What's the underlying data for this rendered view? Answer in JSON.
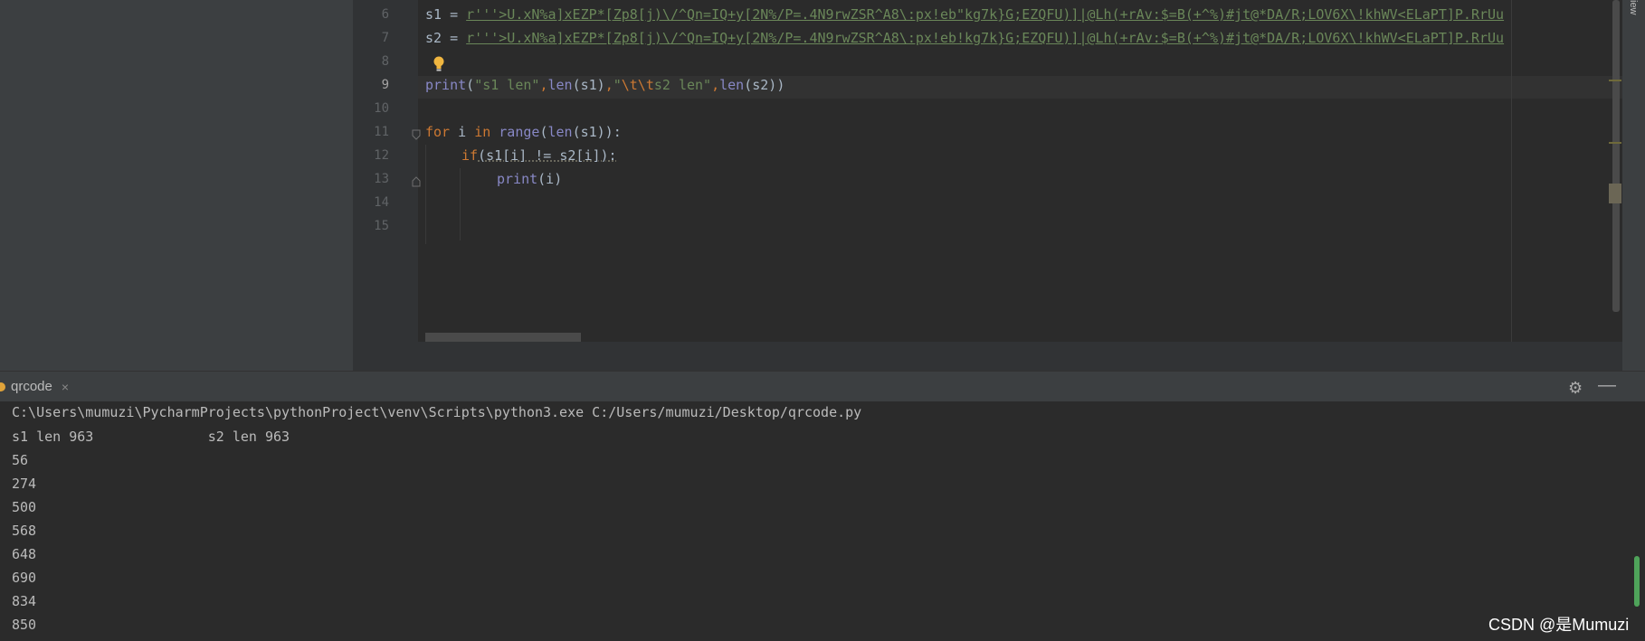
{
  "right_strip_label": "iew",
  "editor": {
    "lines": [
      {
        "num": "6",
        "code": {
          "var": "s1",
          "assign": " = ",
          "string": "r'''>U.xN%a]xEZP*[Zp8[j)\\/^Qn=IQ+y[2N%/P=.4N9rwZSR^A8\\:px!eb\"kg7k}G;EZQFU)]|@Lh(+rAv:$=B(+^%)#jt@*DA/R;LOV6X\\!khWV<ELaPT]P.RrUu"
        }
      },
      {
        "num": "7",
        "code": {
          "var": "s2",
          "assign": " = ",
          "string": "r'''>U.xN%a]xEZP*[Zp8[j)\\/^Qn=IQ+y[2N%/P=.4N9rwZSR^A8\\:px!eb!kg7k}G;EZQFU)]|@Lh(+rAv:$=B(+^%)#jt@*DA/R;LOV6X\\!khWV<ELaPT]P.RrUu"
        }
      },
      {
        "num": "8"
      },
      {
        "num": "9",
        "code": {
          "print": "print",
          "p1": "(",
          "s1": "\"s1 len\"",
          "c1": ",",
          "len1": "len",
          "a1": "(s1)",
          "c2": ",",
          "s2a": "\"",
          "esc": "\\t\\t",
          "s2b": "s2 len\"",
          "c3": ",",
          "len2": "len",
          "a2": "(s2))"
        }
      },
      {
        "num": "10"
      },
      {
        "num": "11",
        "code": {
          "for": "for",
          "i": " i ",
          "in": "in",
          "sp": " ",
          "range": "range",
          "p": "(",
          "len": "len",
          "rest": "(s1)):"
        }
      },
      {
        "num": "12",
        "code": {
          "if": "if",
          "rest": "(s1[i] != s2[i]):"
        }
      },
      {
        "num": "13",
        "code": {
          "print": "print",
          "rest": "(i)"
        }
      },
      {
        "num": "14"
      },
      {
        "num": "15"
      }
    ]
  },
  "run_panel": {
    "tab_label": "qrcode",
    "tab_close": "×",
    "settings_icon": "gear-icon",
    "minimize_icon": "minimize-icon"
  },
  "console": {
    "command": "C:\\Users\\mumuzi\\PycharmProjects\\pythonProject\\venv\\Scripts\\python3.exe C:/Users/mumuzi/Desktop/qrcode.py",
    "summary": "s1 len 963\t\ts2 len 963",
    "outputs": [
      "56",
      "274",
      "500",
      "568",
      "648",
      "690",
      "834",
      "850"
    ]
  },
  "watermark": "CSDN @是Mumuzi",
  "colors": {
    "keyword": "#cc7832",
    "builtin": "#8888c6",
    "string": "#6a8759",
    "text": "#a9b7c6",
    "console_text": "#bbbbbb",
    "bulb": "#f0b640"
  }
}
